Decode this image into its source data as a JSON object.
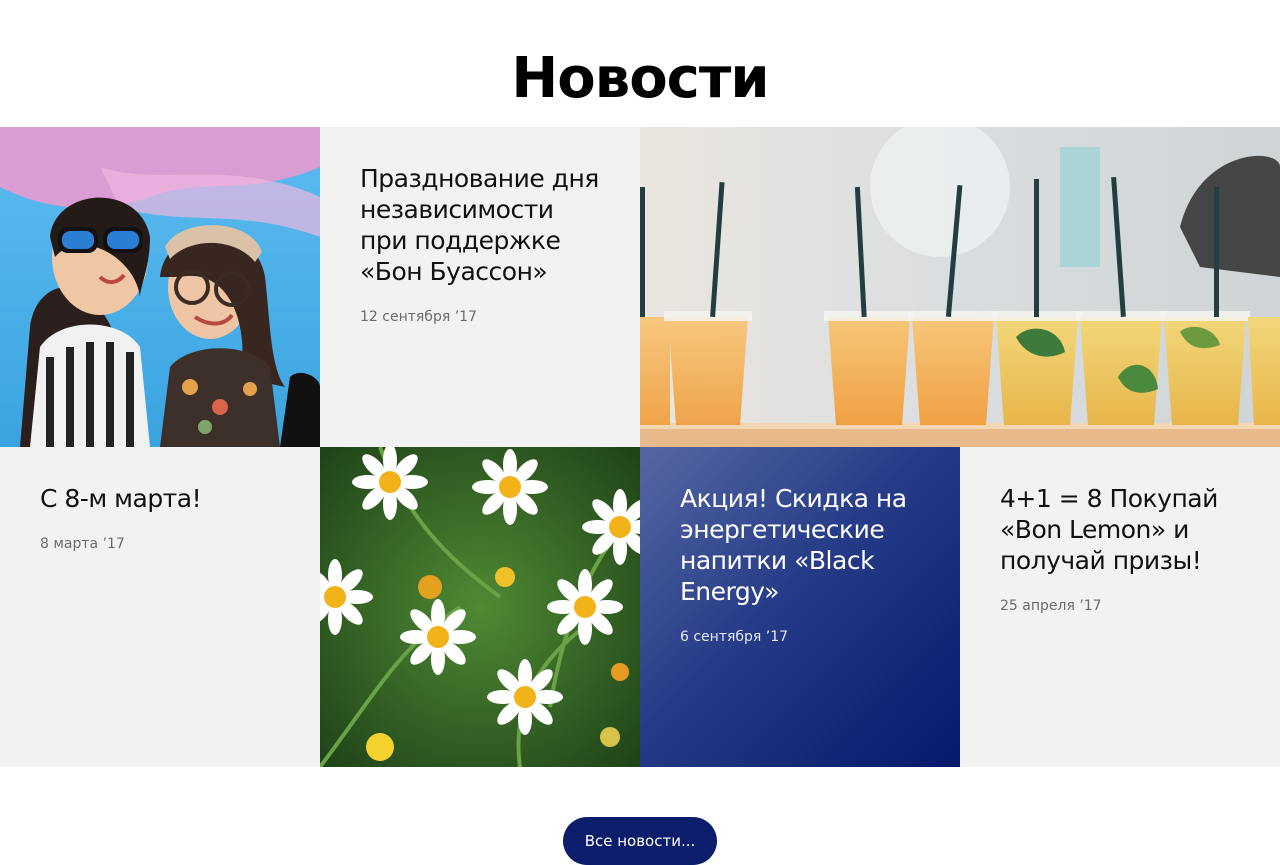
{
  "page": {
    "title": "Новости"
  },
  "news": [
    {
      "title": "Празднование дня независимости при поддержке «Бон Буассон»",
      "date": "12 сентября ’17"
    },
    {
      "title": "С 8-м марта!",
      "date": "8 марта ’17"
    },
    {
      "title": "Акция! Скидка на энергетические напитки «Black Energy»",
      "date": "6 сентября ’17"
    },
    {
      "title": "4+1 = 8 Покупай «Bon Lemon» и получай призы!",
      "date": "25 апреля ’17"
    }
  ],
  "images": {
    "girls": "girls-photo",
    "drinks": "drinks-photo",
    "daisies": "daisies-photo"
  },
  "colors": {
    "accent": "#0b1d6b",
    "tile_bg": "#f2f2f2"
  },
  "footer": {
    "all_news_label": "Все новости..."
  }
}
